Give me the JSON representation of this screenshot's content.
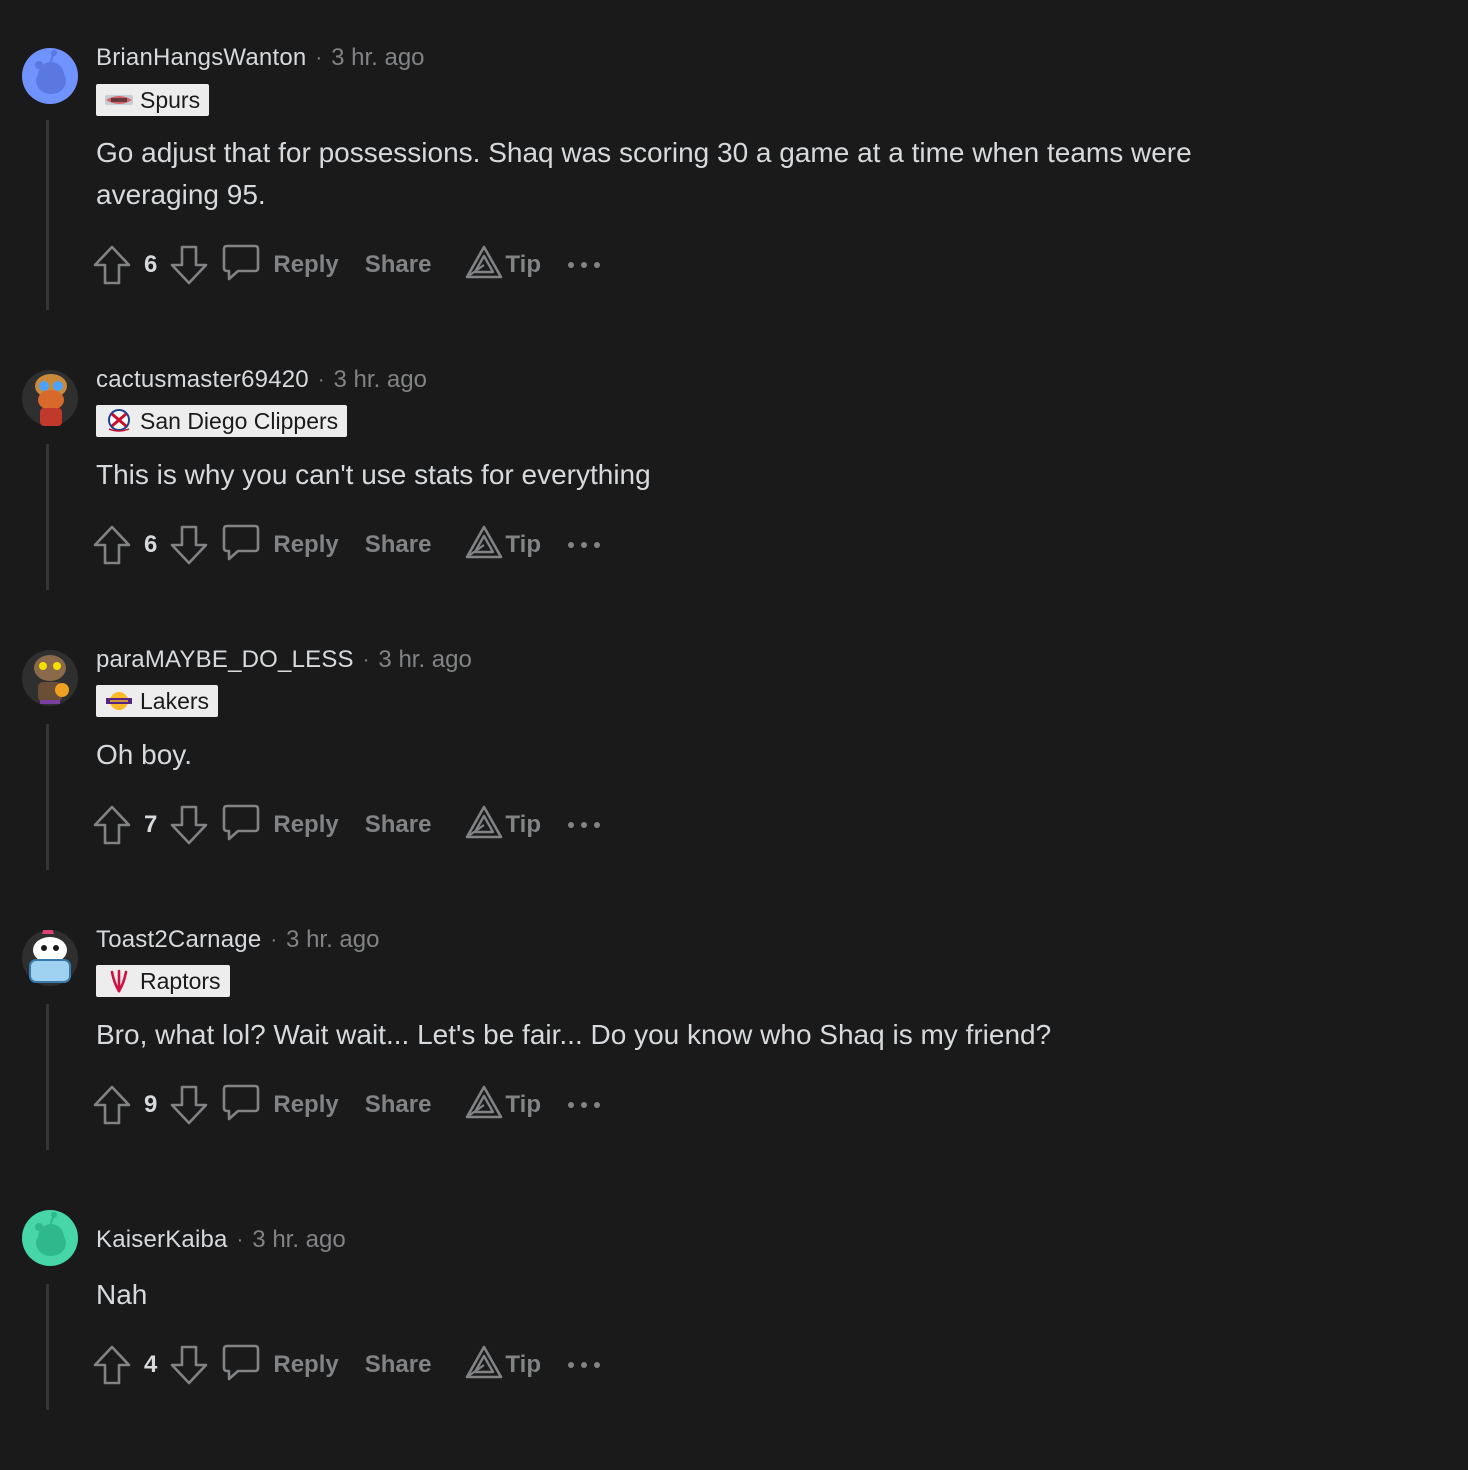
{
  "comments": [
    {
      "username": "BrianHangsWanton",
      "time": "3 hr. ago",
      "flair": "Spurs",
      "flair_icon": "spurs-logo-icon",
      "avatar_color": "#7193ff",
      "body": "Go adjust that for possessions. Shaq was scoring 30 a game at a time when teams were averaging 95.",
      "score": "6",
      "reply": "Reply",
      "share": "Share",
      "tip": "Tip"
    },
    {
      "username": "cactusmaster69420",
      "time": "3 hr. ago",
      "flair": "San Diego Clippers",
      "flair_icon": "san-diego-clippers-logo-icon",
      "avatar_color": "#2f2f2f",
      "body": "This is why you can't use stats for everything",
      "score": "6",
      "reply": "Reply",
      "share": "Share",
      "tip": "Tip"
    },
    {
      "username": "paraMAYBE_DO_LESS",
      "time": "3 hr. ago",
      "flair": "Lakers",
      "flair_icon": "lakers-logo-icon",
      "avatar_color": "#2f2f2f",
      "body": "Oh boy.",
      "score": "7",
      "reply": "Reply",
      "share": "Share",
      "tip": "Tip"
    },
    {
      "username": "Toast2Carnage",
      "time": "3 hr. ago",
      "flair": "Raptors",
      "flair_icon": "raptors-logo-icon",
      "avatar_color": "#2f2f2f",
      "body": "Bro, what lol? Wait wait... Let's be fair... Do you know who Shaq is my friend?",
      "score": "9",
      "reply": "Reply",
      "share": "Share",
      "tip": "Tip"
    },
    {
      "username": "KaiserKaiba",
      "time": "3 hr. ago",
      "flair": "",
      "avatar_color": "#46d6a8",
      "body": "Nah",
      "score": "4",
      "reply": "Reply",
      "share": "Share",
      "tip": "Tip"
    }
  ],
  "separator": "·",
  "colors": {
    "background": "#1a1a1b",
    "text": "#d7dadc",
    "muted": "#818384",
    "thread_line": "#343536",
    "flair_bg": "#ededed"
  }
}
